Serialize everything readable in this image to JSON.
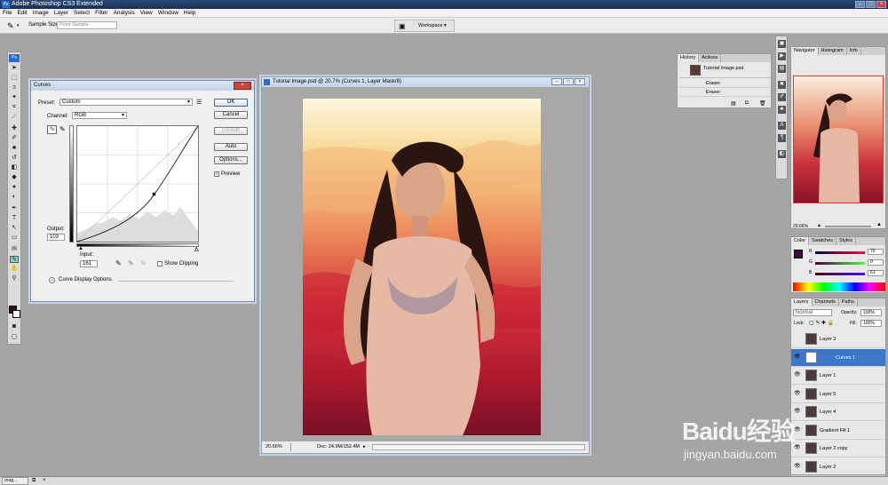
{
  "app": {
    "title": "Adobe Photoshop CS3 Extended",
    "logo": "Ps"
  },
  "menu": [
    "File",
    "Edit",
    "Image",
    "Layer",
    "Select",
    "Filter",
    "Analysis",
    "View",
    "Window",
    "Help"
  ],
  "options": {
    "sample_size_label": "Sample Size:",
    "sample_size_value": "Point Sample",
    "workspace_label": "Workspace"
  },
  "curves": {
    "title": "Curves",
    "preset_label": "Preset:",
    "preset_value": "Custom",
    "channel_label": "Channel:",
    "channel_value": "RGB",
    "output_label": "Output:",
    "output_value": "103",
    "input_label": "Input:",
    "input_value": "161",
    "show_clipping": "Show Clipping",
    "curve_display_options": "Curve Display Options",
    "buttons": {
      "ok": "OK",
      "cancel": "Cancel",
      "smooth": "Smooth",
      "auto": "Auto",
      "options": "Options...",
      "preview": "Preview"
    }
  },
  "document": {
    "title": "Tutorial Image.psd @ 20.7% (Curves 1, Layer Mask/8)",
    "zoom": "20.66%",
    "doc_info": "Doc: 24.9M/152.4M"
  },
  "history": {
    "tabs": [
      "History",
      "Actions"
    ],
    "snapshot": "Tutorial Image.psd",
    "items": [
      "Eraser",
      "Eraser"
    ]
  },
  "navigator": {
    "tabs": [
      "Navigator",
      "Histogram",
      "Info"
    ],
    "zoom": "20.66%"
  },
  "color": {
    "tabs": [
      "Color",
      "Swatches",
      "Styles"
    ],
    "r_label": "R",
    "g_label": "G",
    "b_label": "B",
    "r": "70",
    "g": "0",
    "b": "61",
    "fg_color": "#460a3d"
  },
  "layers": {
    "tabs": [
      "Layers",
      "Channels",
      "Paths"
    ],
    "blend_mode": "Normal",
    "opacity_label": "Opacity:",
    "opacity": "100%",
    "lock_label": "Lock:",
    "fill_label": "Fill:",
    "fill": "100%",
    "items": [
      {
        "name": "Layer 3",
        "visible": false,
        "selected": false
      },
      {
        "name": "Curves 1",
        "visible": true,
        "selected": true
      },
      {
        "name": "Layer 1",
        "visible": true,
        "selected": false
      },
      {
        "name": "Layer 5",
        "visible": true,
        "selected": false
      },
      {
        "name": "Layer 4",
        "visible": true,
        "selected": false
      },
      {
        "name": "Gradient Fill 1",
        "visible": true,
        "selected": false
      },
      {
        "name": "Layer 2 copy",
        "visible": true,
        "selected": false
      },
      {
        "name": "Layer 2",
        "visible": true,
        "selected": false
      }
    ]
  },
  "taskbar": {
    "item": "roug..."
  },
  "watermark": {
    "brand": "Baidu经验",
    "url": "jingyan.baidu.com"
  }
}
